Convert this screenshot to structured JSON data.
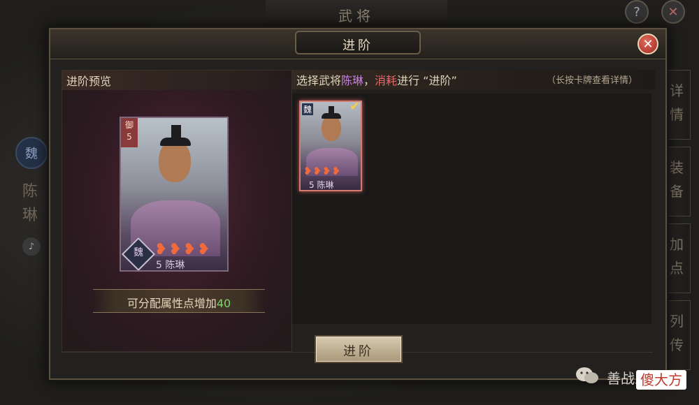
{
  "background": {
    "title": "武将",
    "help_icon": "?",
    "close_icon": "✕",
    "faction_badge": "魏",
    "general_name": "陈琳",
    "side_tabs": [
      "详情",
      "装备",
      "加点",
      "列传"
    ]
  },
  "dialog": {
    "title": "进阶",
    "close_icon": "✕",
    "preview": {
      "title": "进阶预览",
      "card": {
        "badge_type": "御",
        "badge_level": "5",
        "faction": "魏",
        "stars": "❥❥❥❥",
        "star_count": 4,
        "name": "5 陈琳"
      },
      "bonus_text": "可分配属性点增加",
      "bonus_value": "40"
    },
    "selection": {
      "instr_prefix": "选择武将",
      "instr_name": "陈琳",
      "instr_sep": "，",
      "instr_consume": "消耗",
      "instr_suffix": "进行 “进阶”",
      "hint": "（长按卡牌查看详情）",
      "cards": [
        {
          "faction": "魏",
          "stars": "❥❥❥❥",
          "star_count": 4,
          "name": "5 陈琳",
          "selected": true
        }
      ]
    },
    "advance_button": "进阶"
  },
  "watermark": {
    "text": "善战三国",
    "tag": "傻大方"
  }
}
